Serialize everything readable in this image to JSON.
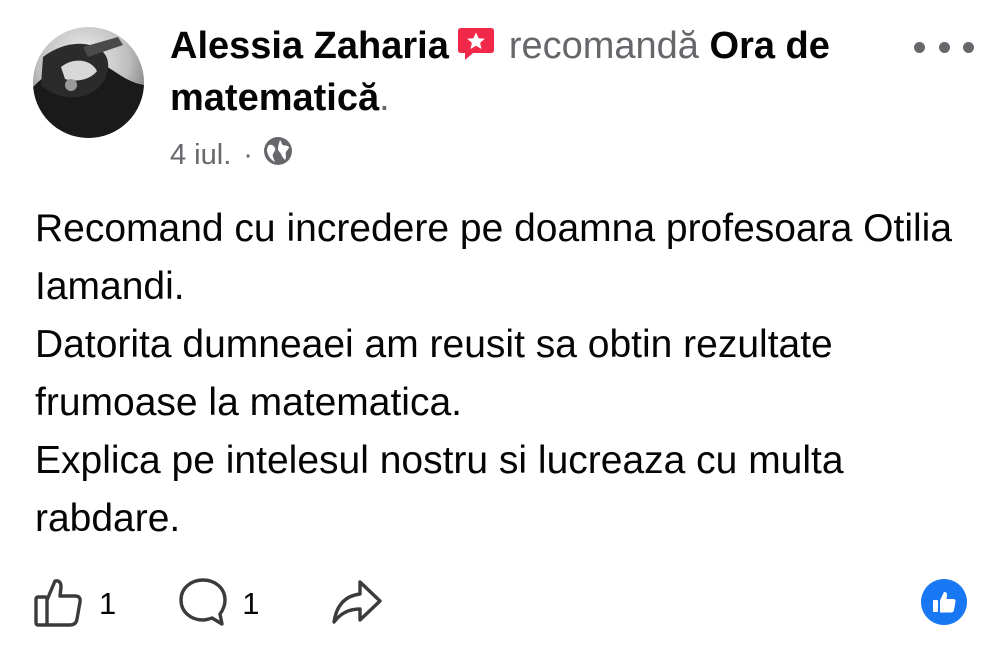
{
  "post": {
    "author": "Alessia Zaharia",
    "verb": "recomandă",
    "page_name": "Ora de matematică",
    "period": ".",
    "date": "4 iul.",
    "separator": "·",
    "privacy_icon": "globe-icon",
    "recommendation_icon": "recommendation-star-icon",
    "menu_icon": "more-options-icon",
    "body": [
      "Recomand cu incredere pe doamna profesoara Otilia Iamandi.",
      "Datorita dumneaei am reusit sa obtin rezultate frumoase la matematica.",
      "Explica pe intelesul nostru si lucreaza cu multa rabdare."
    ]
  },
  "actions": {
    "like_icon": "thumbs-up-icon",
    "like_count": "1",
    "comment_icon": "comment-icon",
    "comment_count": "1",
    "share_icon": "share-icon"
  },
  "reaction": {
    "icon": "like-reaction-icon",
    "color": "#1877f2"
  },
  "colors": {
    "primary_text": "#050505",
    "secondary_text": "#65676b",
    "recommend_badge": "#f02849",
    "like_blue": "#1877f2"
  }
}
